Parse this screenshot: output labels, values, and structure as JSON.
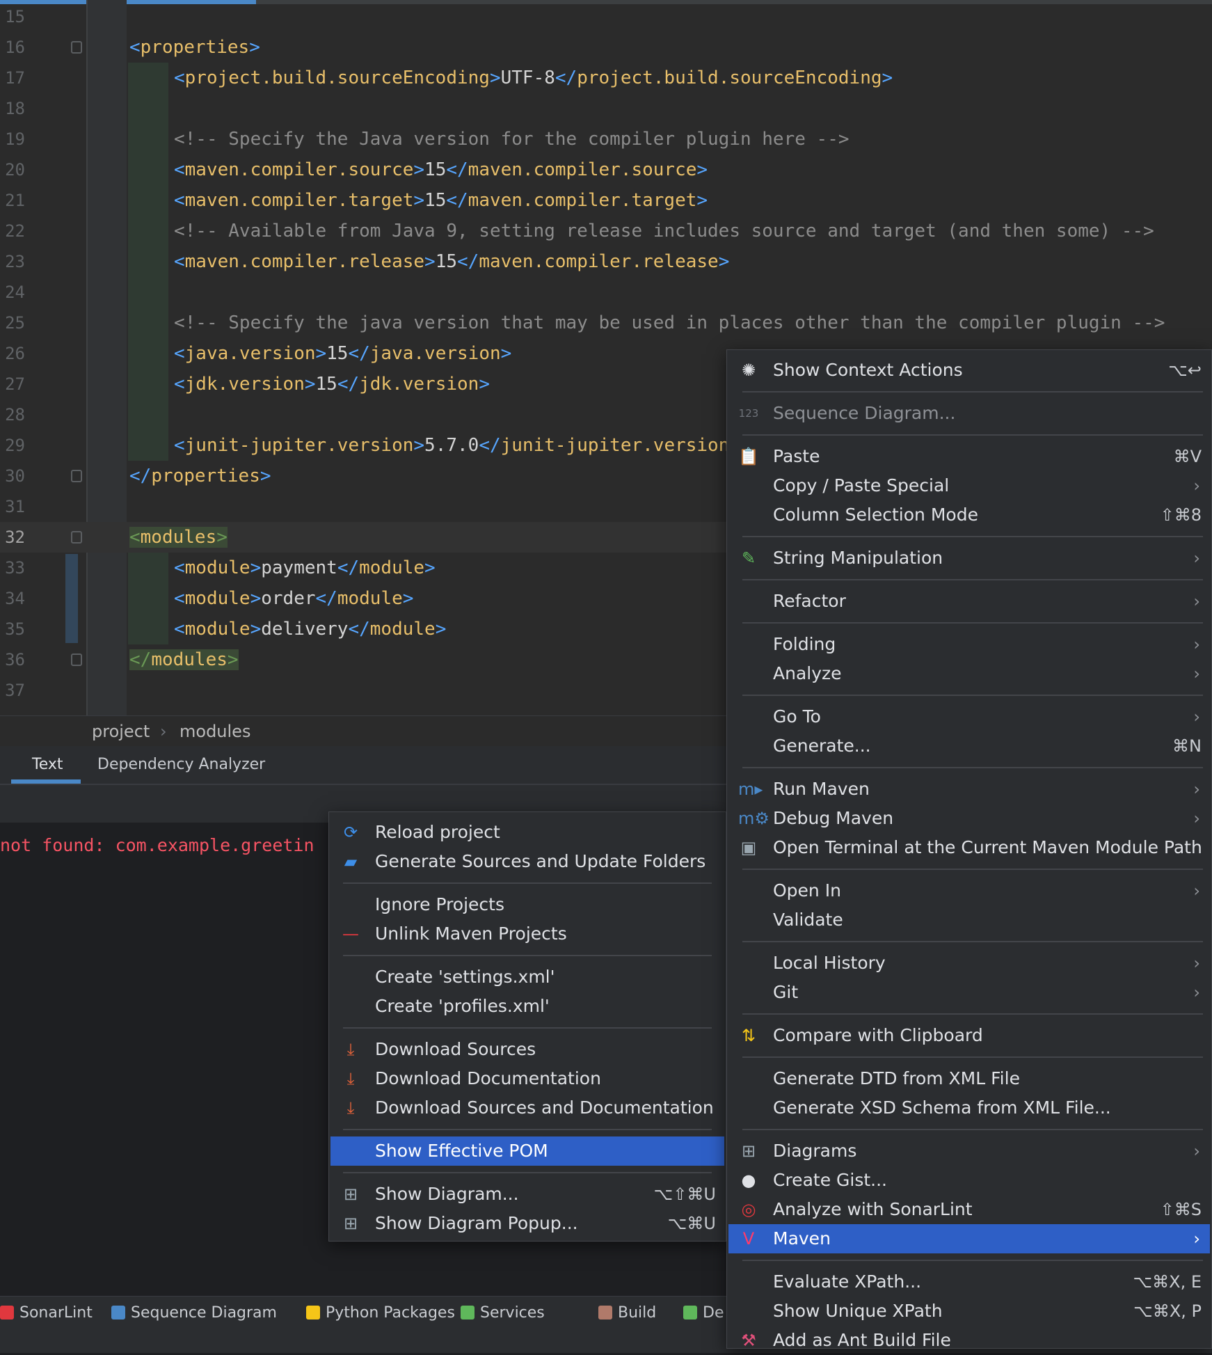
{
  "editor": {
    "lines": [
      {
        "n": "15",
        "indent": false,
        "parts": []
      },
      {
        "n": "16",
        "parts": [
          [
            "b",
            "<"
          ],
          [
            "t",
            "properties"
          ],
          [
            "b",
            ">"
          ]
        ]
      },
      {
        "n": "17",
        "indent": true,
        "parts": [
          [
            "b",
            "<"
          ],
          [
            "t",
            "project.build.sourceEncoding"
          ],
          [
            "b",
            ">"
          ],
          [
            "x",
            "UTF-8"
          ],
          [
            "b",
            "</"
          ],
          [
            "t",
            "project.build.sourceEncoding"
          ],
          [
            "b",
            ">"
          ]
        ]
      },
      {
        "n": "18",
        "indent": true,
        "parts": []
      },
      {
        "n": "19",
        "indent": true,
        "parts": [
          [
            "cm",
            "<!-- Specify the Java version for the compiler plugin here -->"
          ]
        ]
      },
      {
        "n": "20",
        "indent": true,
        "parts": [
          [
            "b",
            "<"
          ],
          [
            "t",
            "maven.compiler.source"
          ],
          [
            "b",
            ">"
          ],
          [
            "x",
            "15"
          ],
          [
            "b",
            "</"
          ],
          [
            "t",
            "maven.compiler.source"
          ],
          [
            "b",
            ">"
          ]
        ]
      },
      {
        "n": "21",
        "indent": true,
        "parts": [
          [
            "b",
            "<"
          ],
          [
            "t",
            "maven.compiler.target"
          ],
          [
            "b",
            ">"
          ],
          [
            "x",
            "15"
          ],
          [
            "b",
            "</"
          ],
          [
            "t",
            "maven.compiler.target"
          ],
          [
            "b",
            ">"
          ]
        ]
      },
      {
        "n": "22",
        "indent": true,
        "parts": [
          [
            "cm",
            "<!-- Available from Java 9, setting release includes source and target (and then some) -->"
          ]
        ]
      },
      {
        "n": "23",
        "indent": true,
        "parts": [
          [
            "b",
            "<"
          ],
          [
            "t",
            "maven.compiler.release"
          ],
          [
            "b",
            ">"
          ],
          [
            "x",
            "15"
          ],
          [
            "b",
            "</"
          ],
          [
            "t",
            "maven.compiler.release"
          ],
          [
            "b",
            ">"
          ]
        ]
      },
      {
        "n": "24",
        "indent": true,
        "parts": []
      },
      {
        "n": "25",
        "indent": true,
        "parts": [
          [
            "cm",
            "<!-- Specify the java version that may be used in places other than the compiler plugin -->"
          ]
        ]
      },
      {
        "n": "26",
        "indent": true,
        "parts": [
          [
            "b",
            "<"
          ],
          [
            "t",
            "java.version"
          ],
          [
            "b",
            ">"
          ],
          [
            "x",
            "15"
          ],
          [
            "b",
            "</"
          ],
          [
            "t",
            "java.version"
          ],
          [
            "b",
            ">"
          ]
        ]
      },
      {
        "n": "27",
        "indent": true,
        "parts": [
          [
            "b",
            "<"
          ],
          [
            "t",
            "jdk.version"
          ],
          [
            "b",
            ">"
          ],
          [
            "x",
            "15"
          ],
          [
            "b",
            "</"
          ],
          [
            "t",
            "jdk.version"
          ],
          [
            "b",
            ">"
          ]
        ]
      },
      {
        "n": "28",
        "indent": true,
        "parts": []
      },
      {
        "n": "29",
        "indent": true,
        "parts": [
          [
            "b",
            "<"
          ],
          [
            "t",
            "junit-jupiter.version"
          ],
          [
            "b",
            ">"
          ],
          [
            "x",
            "5.7.0"
          ],
          [
            "b",
            "</"
          ],
          [
            "t",
            "junit-jupiter.version"
          ]
        ]
      },
      {
        "n": "30",
        "parts": [
          [
            "b",
            "</"
          ],
          [
            "t",
            "properties"
          ],
          [
            "b",
            ">"
          ]
        ]
      },
      {
        "n": "31",
        "parts": []
      },
      {
        "n": "32",
        "current": true,
        "parts": [
          [
            "hb",
            "<"
          ],
          [
            "ht",
            "modules"
          ],
          [
            "hb",
            ">"
          ]
        ]
      },
      {
        "n": "33",
        "indent": true,
        "parts": [
          [
            "b",
            "<"
          ],
          [
            "t",
            "module"
          ],
          [
            "b",
            ">"
          ],
          [
            "x",
            "payment"
          ],
          [
            "b",
            "</"
          ],
          [
            "t",
            "module"
          ],
          [
            "b",
            ">"
          ]
        ]
      },
      {
        "n": "34",
        "indent": true,
        "parts": [
          [
            "b",
            "<"
          ],
          [
            "t",
            "module"
          ],
          [
            "b",
            ">"
          ],
          [
            "x",
            "order"
          ],
          [
            "b",
            "</"
          ],
          [
            "t",
            "module"
          ],
          [
            "b",
            ">"
          ]
        ]
      },
      {
        "n": "35",
        "indent": true,
        "parts": [
          [
            "b",
            "<"
          ],
          [
            "t",
            "module"
          ],
          [
            "b",
            ">"
          ],
          [
            "x",
            "delivery"
          ],
          [
            "b",
            "</"
          ],
          [
            "t",
            "module"
          ],
          [
            "b",
            ">"
          ]
        ]
      },
      {
        "n": "36",
        "parts": [
          [
            "hb",
            "</"
          ],
          [
            "ht",
            "modules"
          ],
          [
            "hb",
            ">"
          ]
        ]
      },
      {
        "n": "37",
        "parts": []
      }
    ]
  },
  "breadcrumb": {
    "items": [
      "project",
      "modules"
    ],
    "separator": "›"
  },
  "tabs": {
    "text": "Text",
    "dependency_analyzer": "Dependency Analyzer"
  },
  "console": {
    "error_line": "not found: com.example.greetin"
  },
  "statusbar": {
    "items": [
      {
        "label": "SonarLint",
        "color": "#e0383e"
      },
      {
        "label": "Sequence Diagram",
        "color": "#4a88c7"
      },
      {
        "label": "Python Packages",
        "color": "#f5c518"
      },
      {
        "label": "Services",
        "color": "#5fb85b"
      },
      {
        "label": "Build",
        "color": "#b07a6a"
      },
      {
        "label": "De",
        "color": "#5fb85b"
      }
    ]
  },
  "maven_submenu": {
    "items": [
      {
        "label": "Reload project",
        "icon": "reload-icon",
        "glyph": "⟳",
        "color": "#3d8ee8"
      },
      {
        "label": "Generate Sources and Update Folders",
        "icon": "folder-refresh-icon",
        "glyph": "▰",
        "color": "#3d8ee8"
      },
      {
        "sep": true
      },
      {
        "label": "Ignore Projects"
      },
      {
        "label": "Unlink Maven Projects",
        "icon": "minus-icon",
        "glyph": "—",
        "color": "#e0383e"
      },
      {
        "sep": true
      },
      {
        "label": "Create 'settings.xml'"
      },
      {
        "label": "Create 'profiles.xml'"
      },
      {
        "sep": true
      },
      {
        "label": "Download Sources",
        "icon": "download-icon",
        "glyph": "⤓",
        "color": "#e8643a"
      },
      {
        "label": "Download Documentation",
        "icon": "download-icon",
        "glyph": "⤓",
        "color": "#e8643a"
      },
      {
        "label": "Download Sources and Documentation",
        "icon": "download-icon",
        "glyph": "⤓",
        "color": "#e8643a"
      },
      {
        "sep": true
      },
      {
        "label": "Show Effective POM",
        "selected": true
      },
      {
        "sep": true
      },
      {
        "label": "Show Diagram...",
        "icon": "diagram-icon",
        "glyph": "⊞",
        "color": "#9aa7b0",
        "shortcut": "⌥⇧⌘U"
      },
      {
        "label": "Show Diagram Popup...",
        "icon": "diagram-icon",
        "glyph": "⊞",
        "color": "#9aa7b0",
        "shortcut": "⌥⌘U"
      }
    ]
  },
  "context_menu": {
    "items": [
      {
        "label": "Show Context Actions",
        "icon": "lightbulb-icon",
        "glyph": "✺",
        "color": "#dfe1e5",
        "shortcut": "⌥↩"
      },
      {
        "sep": true
      },
      {
        "label": "Sequence Diagram...",
        "icon": "sequence-123-icon",
        "glyph": "123",
        "color": "#6f737a",
        "disabled": true
      },
      {
        "sep": true
      },
      {
        "label": "Paste",
        "icon": "clipboard-icon",
        "glyph": "📋",
        "color": "#f5c518",
        "shortcut": "⌘V"
      },
      {
        "label": "Copy / Paste Special",
        "arrow": true
      },
      {
        "label": "Column Selection Mode",
        "shortcut": "⇧⌘8"
      },
      {
        "sep": true
      },
      {
        "label": "String Manipulation",
        "icon": "pencil-icon",
        "glyph": "✎",
        "color": "#5fb85b",
        "arrow": true
      },
      {
        "sep": true
      },
      {
        "label": "Refactor",
        "arrow": true
      },
      {
        "sep": true
      },
      {
        "label": "Folding",
        "arrow": true
      },
      {
        "label": "Analyze",
        "arrow": true
      },
      {
        "sep": true
      },
      {
        "label": "Go To",
        "arrow": true
      },
      {
        "label": "Generate...",
        "shortcut": "⌘N"
      },
      {
        "sep": true
      },
      {
        "label": "Run Maven",
        "icon": "maven-run-icon",
        "glyph": "m▸",
        "color": "#4a88c7",
        "arrow": true
      },
      {
        "label": "Debug Maven",
        "icon": "maven-debug-icon",
        "glyph": "m⚙",
        "color": "#4a88c7",
        "arrow": true
      },
      {
        "label": "Open Terminal at the Current Maven Module Path",
        "icon": "terminal-maven-icon",
        "glyph": "▣",
        "color": "#9aa7b0"
      },
      {
        "sep": true
      },
      {
        "label": "Open In",
        "arrow": true
      },
      {
        "label": "Validate"
      },
      {
        "sep": true
      },
      {
        "label": "Local History",
        "arrow": true
      },
      {
        "label": "Git",
        "arrow": true
      },
      {
        "sep": true
      },
      {
        "label": "Compare with Clipboard",
        "icon": "compare-clipboard-icon",
        "glyph": "⇅",
        "color": "#f5c518"
      },
      {
        "sep": true
      },
      {
        "label": "Generate DTD from XML File"
      },
      {
        "label": "Generate XSD Schema from XML File..."
      },
      {
        "sep": true
      },
      {
        "label": "Diagrams",
        "icon": "diagram-icon",
        "glyph": "⊞",
        "color": "#9aa7b0",
        "arrow": true
      },
      {
        "label": "Create Gist...",
        "icon": "github-icon",
        "glyph": "●",
        "color": "#dfe1e5"
      },
      {
        "label": "Analyze with SonarLint",
        "icon": "sonarlint-icon",
        "glyph": "◎",
        "color": "#e0383e",
        "shortcut": "⇧⌘S"
      },
      {
        "label": "Maven",
        "icon": "maven-icon",
        "glyph": "V",
        "color": "#ff3b6b",
        "arrow": true,
        "selected": true
      },
      {
        "sep": true
      },
      {
        "label": "Evaluate XPath...",
        "shortcut": "⌥⌘X, E"
      },
      {
        "label": "Show Unique XPath",
        "shortcut": "⌥⌘X, P"
      },
      {
        "label": "Add as Ant Build File",
        "icon": "ant-icon",
        "glyph": "⚒",
        "color": "#e0507a"
      }
    ]
  }
}
